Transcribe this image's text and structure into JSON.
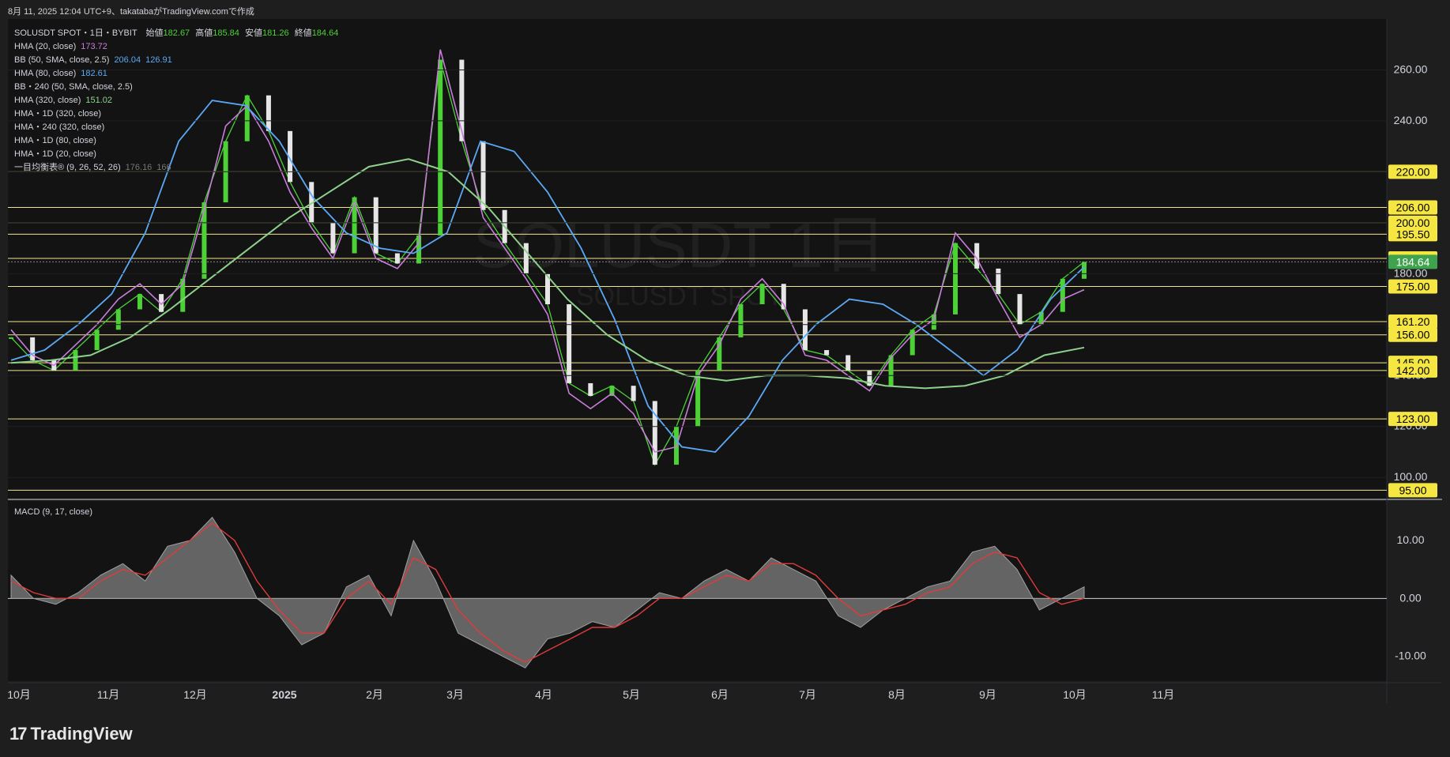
{
  "header": {
    "text": "8月 11, 2025 12:04 UTC+9、takatabaがTradingView.comで作成"
  },
  "legend": {
    "symbol": "SOLUSDT SPOT・1日・BYBIT",
    "open_label": "始値",
    "open": "182.67",
    "high_label": "高値",
    "high": "185.84",
    "low_label": "安値",
    "low": "181.26",
    "close_label": "終値",
    "close": "184.64",
    "hma20": {
      "label": "HMA (20, close)",
      "value": "173.72"
    },
    "bb": {
      "label": "BB (50, SMA, close, 2.5)",
      "upper": "206.04",
      "lower": "126.91"
    },
    "hma80": {
      "label": "HMA (80, close)",
      "value": "182.61"
    },
    "bb240": {
      "label": "BB・240 (50, SMA, close, 2.5)"
    },
    "hma320": {
      "label": "HMA (320, close)",
      "value": "151.02"
    },
    "hma1d320": {
      "label": "HMA・1D (320, close)"
    },
    "hma240": {
      "label": "HMA・240 (320, close)"
    },
    "hma1d80": {
      "label": "HMA・1D (80, close)"
    },
    "hma1d20": {
      "label": "HMA・1D (20, close)"
    },
    "ichimoku": {
      "label": "一目均衡表® (9, 26, 52, 26)",
      "v1": "176.16",
      "v2": "166"
    }
  },
  "watermark": {
    "big": "SOLUSDT 1日",
    "small": "SOLUSDT SPOT"
  },
  "colors": {
    "background": "#131313",
    "up_candle": "#4cd137",
    "down_candle": "#e6e6e6",
    "hma20": "#c77dd9",
    "bb": "#3d7fd9",
    "hma80": "#5ba8f5",
    "hma320": "#8fd18c",
    "level_line": "#f0e68c",
    "level_tag": "#f5e642",
    "price_tag": "#3fa34d",
    "macd_fill": "#808080",
    "macd_signal": "#e03b3b"
  },
  "macd": {
    "label": "MACD (9, 17, close)"
  },
  "brand": {
    "name": "TradingView",
    "logo": "17"
  },
  "chart_data": [
    {
      "type": "line",
      "title": "SOLUSDT SPOT・1日・BYBIT",
      "x_labels": [
        "10月",
        "11月",
        "12月",
        "2025",
        "2月",
        "3月",
        "4月",
        "5月",
        "6月",
        "7月",
        "8月",
        "9月",
        "10月",
        "11月"
      ],
      "y_ticks": [
        100,
        120,
        140,
        160,
        180,
        200,
        220,
        240,
        260
      ],
      "ylim": [
        92,
        280
      ],
      "levels": [
        220,
        206,
        200,
        195.5,
        186,
        175,
        161.2,
        156,
        145,
        142,
        123,
        95
      ],
      "level_labels": [
        "220.00",
        "206.00",
        "200.00",
        "195.50",
        "186.00",
        "175.00",
        "161.20",
        "156.00",
        "145.00",
        "142.00",
        "123.00",
        "95.00"
      ],
      "last_price": 184.64,
      "last_price_label": "184.64",
      "series": [
        {
          "key": "close",
          "values": [
            155,
            146,
            142,
            150,
            158,
            166,
            172,
            165,
            178,
            208,
            232,
            250,
            236,
            216,
            200,
            188,
            210,
            188,
            184,
            195,
            264,
            232,
            205,
            192,
            180,
            168,
            137,
            132,
            136,
            130,
            105,
            120,
            142,
            155,
            168,
            176,
            166,
            150,
            148,
            142,
            136,
            148,
            158,
            164,
            192,
            182,
            172,
            160,
            165,
            178,
            184.64
          ]
        },
        {
          "key": "hma20",
          "values": [
            158,
            148,
            144,
            152,
            160,
            170,
            176,
            168,
            176,
            205,
            238,
            246,
            232,
            212,
            198,
            186,
            208,
            186,
            182,
            192,
            268,
            236,
            202,
            190,
            178,
            164,
            133,
            127,
            133,
            125,
            110,
            112,
            140,
            152,
            170,
            178,
            168,
            148,
            146,
            140,
            134,
            147,
            156,
            162,
            196,
            186,
            170,
            155,
            160,
            170,
            173.72
          ]
        },
        {
          "key": "hma80",
          "values": [
            146,
            150,
            160,
            172,
            196,
            232,
            248,
            246,
            232,
            210,
            196,
            190,
            188,
            196,
            232,
            228,
            212,
            190,
            162,
            128,
            112,
            110,
            124,
            146,
            160,
            170,
            168,
            160,
            150,
            140,
            150,
            170,
            182.61
          ]
        },
        {
          "key": "hma320",
          "values": [
            145,
            146,
            148,
            155,
            166,
            178,
            190,
            202,
            212,
            222,
            225,
            220,
            206,
            188,
            170,
            156,
            146,
            140,
            138,
            140,
            140,
            139,
            136,
            135,
            136,
            140,
            148,
            151.02
          ]
        }
      ]
    },
    {
      "type": "area",
      "title": "MACD (9, 17, close)",
      "y_ticks": [
        -10,
        0,
        10
      ],
      "ylim": [
        -14,
        16
      ],
      "series": [
        {
          "key": "macd",
          "values": [
            4,
            0,
            -1,
            1,
            4,
            6,
            3,
            9,
            10,
            14,
            8,
            0,
            -3,
            -8,
            -6,
            2,
            4,
            -3,
            10,
            3,
            -6,
            -8,
            -10,
            -12,
            -7,
            -6,
            -4,
            -5,
            -2,
            1,
            0,
            3,
            5,
            3,
            7,
            5,
            3,
            -3,
            -5,
            -2,
            0,
            2,
            3,
            8,
            9,
            5,
            -2,
            0,
            2
          ]
        },
        {
          "key": "signal",
          "values": [
            3,
            1,
            0,
            0,
            3,
            5,
            4,
            7,
            10,
            13,
            10,
            3,
            -2,
            -6,
            -6,
            0,
            3,
            -1,
            7,
            5,
            -2,
            -6,
            -9,
            -11,
            -9,
            -7,
            -5,
            -5,
            -3,
            0,
            0,
            2,
            4,
            3,
            6,
            6,
            4,
            0,
            -3,
            -2,
            -1,
            1,
            2,
            6,
            8,
            7,
            1,
            -1,
            0
          ]
        }
      ]
    }
  ]
}
